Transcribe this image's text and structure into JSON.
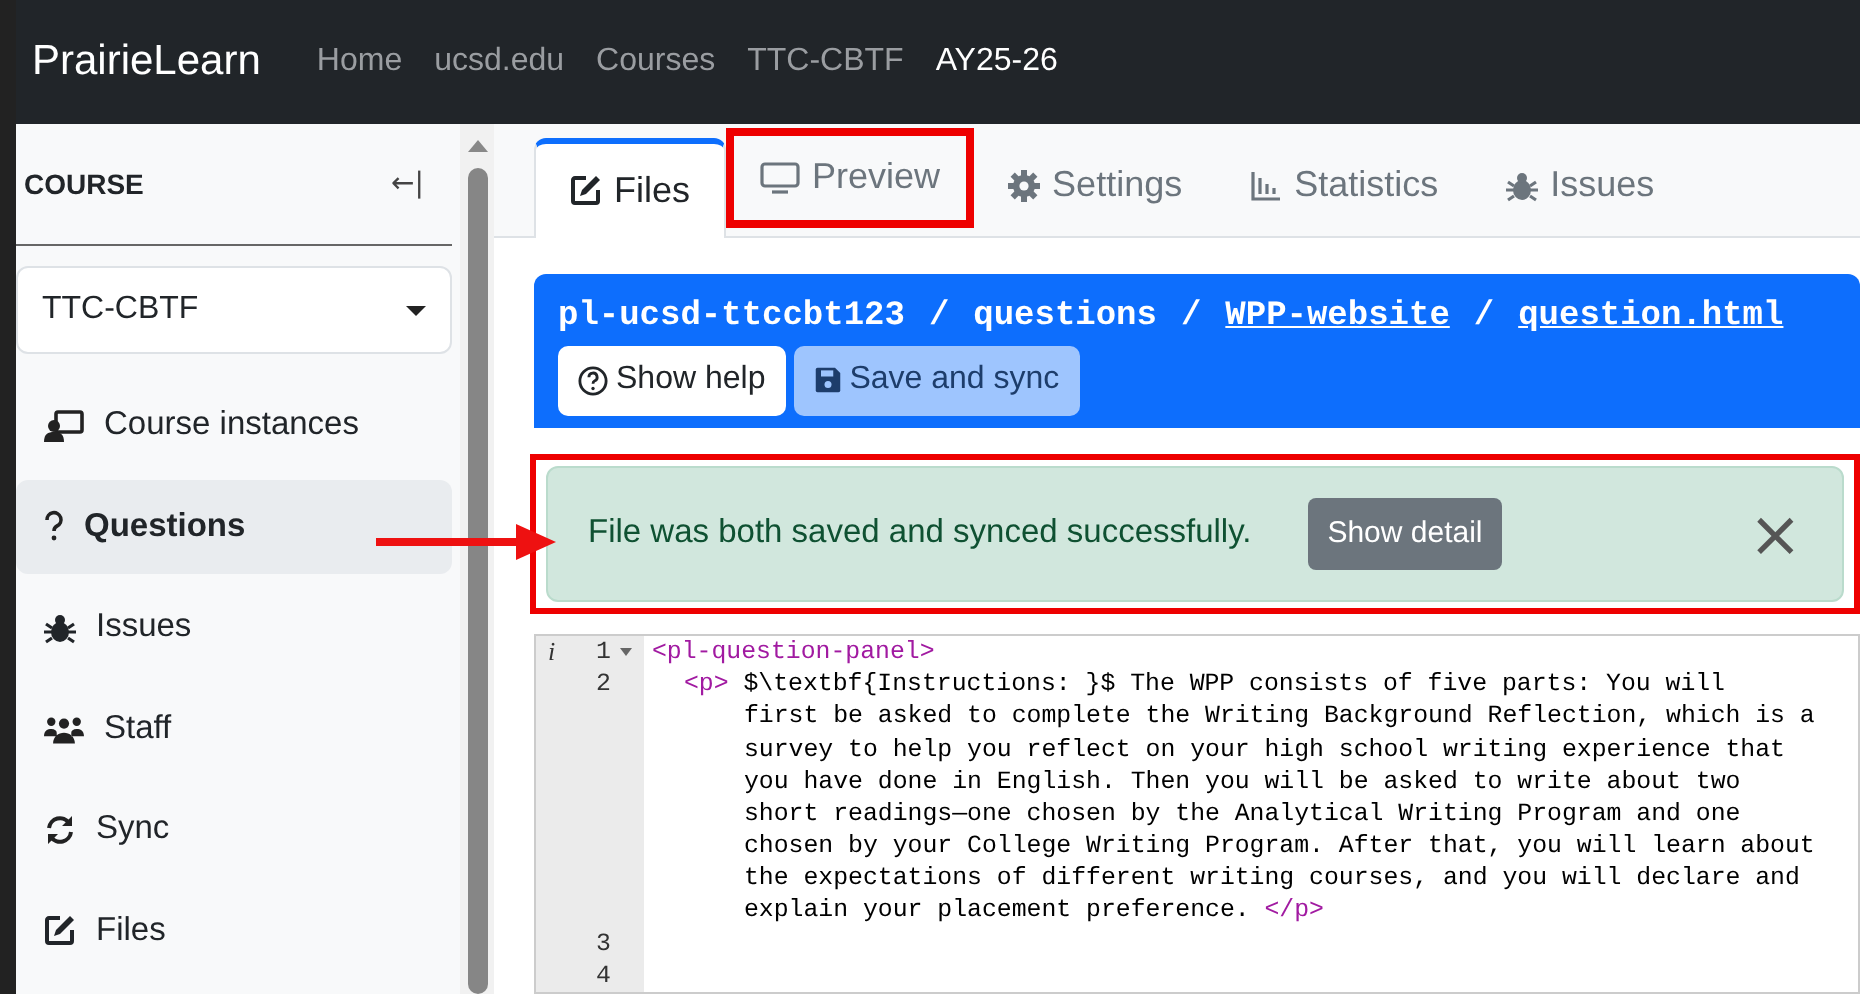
{
  "navbar": {
    "brand": "PrairieLearn",
    "items": [
      {
        "label": "Home",
        "selected": false
      },
      {
        "label": "ucsd.edu",
        "selected": false
      },
      {
        "label": "Courses",
        "selected": false
      },
      {
        "label": "TTC-CBTF",
        "selected": false
      },
      {
        "label": "AY25-26",
        "selected": true
      }
    ]
  },
  "sidebar": {
    "heading": "COURSE",
    "collapse": "←|",
    "course_select": "TTC-CBTF",
    "items": [
      {
        "label": "Course instances",
        "selected": false
      },
      {
        "label": "Questions",
        "selected": true
      },
      {
        "label": "Issues",
        "selected": false
      },
      {
        "label": "Staff",
        "selected": false
      },
      {
        "label": "Sync",
        "selected": false
      },
      {
        "label": "Files",
        "selected": false
      }
    ]
  },
  "tabs": [
    {
      "label": "Files",
      "selected": true,
      "highlighted": false
    },
    {
      "label": "Preview",
      "selected": false,
      "highlighted": true
    },
    {
      "label": "Settings",
      "selected": false,
      "highlighted": false
    },
    {
      "label": "Statistics",
      "selected": false,
      "highlighted": false
    },
    {
      "label": "Issues",
      "selected": false,
      "highlighted": false
    }
  ],
  "file_header": {
    "path": [
      {
        "text": "pl-ucsd-ttccbt123",
        "link": false
      },
      {
        "text": "questions",
        "link": false
      },
      {
        "text": "WPP-website",
        "link": true
      },
      {
        "text": "question.html",
        "link": true
      }
    ],
    "separator": "/",
    "buttons": [
      {
        "label": "Show help",
        "disabled": false
      },
      {
        "label": "Save and sync",
        "disabled": true
      }
    ]
  },
  "alert": {
    "message": "File was both saved and synced successfully.",
    "button": "Show detail",
    "close": "×",
    "highlighted": true
  },
  "editor": {
    "info_marker": "i",
    "lines": [
      {
        "number": "1",
        "fold": true,
        "rows": [
          {
            "tag_open": "<pl-question-panel>",
            "text": "",
            "tag_close": ""
          }
        ]
      },
      {
        "number": "2",
        "fold": false,
        "rows": [
          {
            "tag_open": "<p>",
            "text": " $\\textbf{Instructions: }$ The WPP consists of five parts: You will",
            "tag_close": ""
          },
          {
            "tag_open": "",
            "text": "first be asked to complete the Writing Background Reflection, which is a",
            "tag_close": ""
          },
          {
            "tag_open": "",
            "text": "survey to help you reflect on your high school writing experience that",
            "tag_close": ""
          },
          {
            "tag_open": "",
            "text": "you have done in English. Then you will be asked to write about two",
            "tag_close": ""
          },
          {
            "tag_open": "",
            "text": "short readings—one chosen by the Analytical Writing Program and one",
            "tag_close": ""
          },
          {
            "tag_open": "",
            "text": "chosen by your College Writing Program. After that, you will learn about",
            "tag_close": ""
          },
          {
            "tag_open": "",
            "text": "the expectations of different writing courses, and you will declare and",
            "tag_close": ""
          },
          {
            "tag_open": "",
            "text": "explain your placement preference. ",
            "tag_close": "</p>"
          }
        ]
      },
      {
        "number": "3",
        "fold": false
      },
      {
        "number": "4",
        "fold": false
      }
    ]
  },
  "annotations": {
    "arrow": true
  }
}
